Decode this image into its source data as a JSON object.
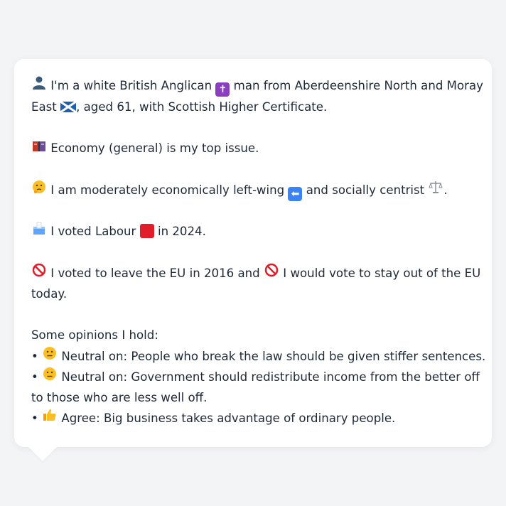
{
  "persona": {
    "line1_a": "I'm a white British Anglican",
    "line1_b": "man from Aberdeenshire North and Moray",
    "line2_a": "East",
    "line2_b": ", aged 61, with Scottish Higher Certificate.",
    "top_issue": "Economy (general) is my top issue.",
    "ideology_a": "I am moderately economically left-wing",
    "ideology_b": "and socially centrist",
    "ideology_c": ".",
    "vote_a": "I voted Labour",
    "vote_b": "in 2024.",
    "eu_a": "I voted to leave the EU in 2016 and",
    "eu_b": "I would vote to stay out of the EU",
    "eu_c": "today.",
    "opinions_heading": "Some opinions I hold:",
    "opinions": [
      {
        "bullet": "•",
        "text": "Neutral on: People who break the law should be given stiffer sentences."
      },
      {
        "bullet": "•",
        "text_a": "Neutral on: Government should redistribute income from the better off",
        "text_b": "to those who are less well off."
      },
      {
        "bullet": "•",
        "text": "Agree: Big business takes advantage of ordinary people."
      }
    ]
  },
  "icons": {
    "person": "person-silhouette-icon",
    "cross": "latin-cross-icon",
    "flag": "scotland-flag-icon",
    "economy": "ledger-book-icon",
    "thinking": "thinking-face-icon",
    "left_arrow": "left-arrow-icon",
    "balance": "balance-scale-icon",
    "ballot": "ballot-box-icon",
    "labour": "red-square-icon",
    "no_entry": "prohibited-icon",
    "neutral": "neutral-face-icon",
    "thumbs_up": "thumbs-up-icon"
  },
  "colors": {
    "card_bg": "#ffffff",
    "page_bg": "#f3f4f6",
    "text": "#1f2937",
    "labour_red": "#e11d2a",
    "purple_box": "#8b3fbf",
    "blue_box": "#3b82f6",
    "flag_blue": "#1f5fae"
  }
}
